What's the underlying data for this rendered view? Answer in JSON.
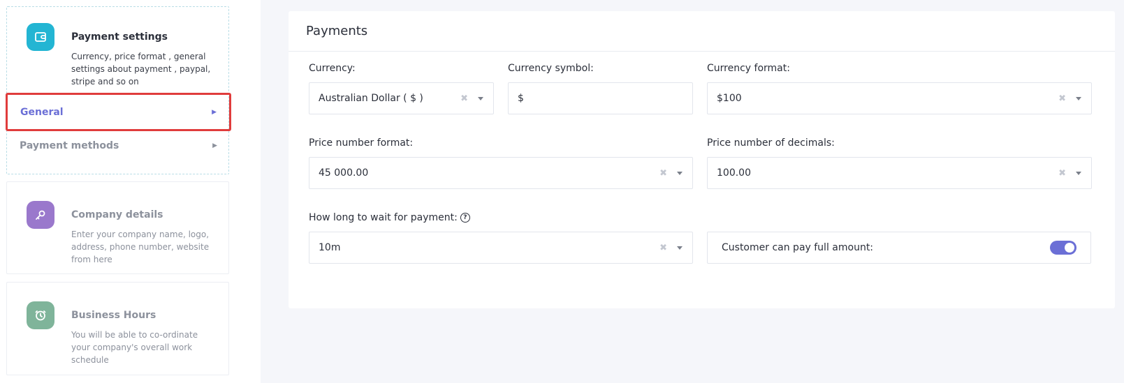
{
  "sidebar": {
    "payment": {
      "title": "Payment settings",
      "description": "Currency, price format , general settings about payment , paypal, stripe and so on",
      "icon": "wallet-icon",
      "color": "#23b5d3",
      "items": [
        {
          "label": "General"
        },
        {
          "label": "Payment methods"
        }
      ]
    },
    "company": {
      "title": "Company details",
      "description": "Enter your company name, logo, address, phone number, website from here",
      "icon": "wrench-icon",
      "color": "#9a78cc"
    },
    "hours": {
      "title": "Business Hours",
      "description": "You will be able to co-ordinate your company's overall work schedule",
      "icon": "clock-icon",
      "color": "#7fb49a"
    }
  },
  "panel": {
    "title": "Payments",
    "currency": {
      "label": "Currency:",
      "value": "Australian Dollar ( $ )"
    },
    "currency_symbol": {
      "label": "Currency symbol:",
      "value": "$"
    },
    "currency_format": {
      "label": "Currency format:",
      "value": "$100"
    },
    "price_number_format": {
      "label": "Price number format:",
      "value": "45 000.00"
    },
    "price_decimals": {
      "label": "Price number of decimals:",
      "value": "100.00"
    },
    "wait_payment": {
      "label": "How long to wait for payment:",
      "value": "10m"
    },
    "full_amount": {
      "label": "Customer can pay full amount:",
      "enabled": true
    }
  },
  "colors": {
    "accent": "#6b6fd6",
    "highlight": "#e03c3c"
  }
}
